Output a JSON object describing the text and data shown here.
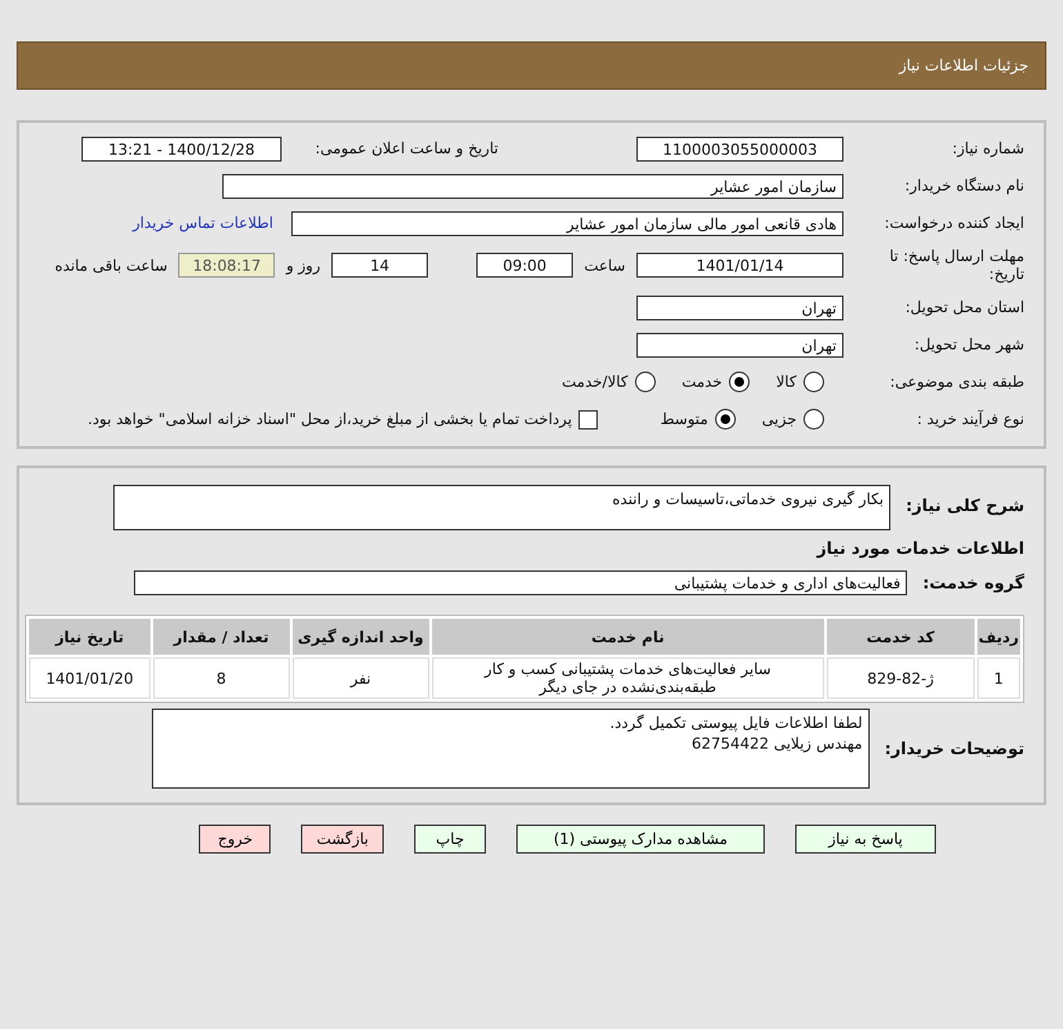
{
  "header": {
    "title": "جزئیات اطلاعات نیاز"
  },
  "details": {
    "need_number": {
      "label": "شماره نیاز:",
      "value": "1100003055000003"
    },
    "announce": {
      "label": "تاریخ و ساعت اعلان عمومی:",
      "value": "1400/12/28 - 13:21"
    },
    "buyer": {
      "label": "نام دستگاه خریدار:",
      "value": "سازمان امور عشایر"
    },
    "requester": {
      "label": "ایجاد کننده درخواست:",
      "value": "هادی قانعی امور مالی سازمان امور عشایر",
      "link": "اطلاعات تماس خریدار"
    },
    "deadline": {
      "label": "مهلت ارسال پاسخ: تا تاریخ:",
      "date": "1401/01/14",
      "time_label": "ساعت",
      "time": "09:00",
      "days": "14",
      "days_label": "روز و",
      "remaining": "18:08:17",
      "remaining_label": "ساعت باقی مانده"
    },
    "province": {
      "label": "استان محل تحویل:",
      "value": "تهران"
    },
    "city": {
      "label": "شهر محل تحویل:",
      "value": "تهران"
    },
    "category": {
      "label": "طبقه بندی موضوعی:",
      "options": [
        {
          "label": "کالا",
          "selected": false
        },
        {
          "label": "خدمت",
          "selected": true
        },
        {
          "label": "کالا/خدمت",
          "selected": false
        }
      ]
    },
    "process": {
      "label": "نوع فرآیند خرید :",
      "options": [
        {
          "label": "جزیی",
          "selected": false
        },
        {
          "label": "متوسط",
          "selected": true
        }
      ],
      "payment": {
        "label": "پرداخت تمام یا بخشی از مبلغ خرید،از محل \"اسناد خزانه اسلامی\" خواهد بود.",
        "checked": false
      }
    }
  },
  "summary": {
    "description": {
      "label": "شرح کلی نیاز:",
      "value": "بکار گیری نیروی خدماتی،تاسیسات و راننده"
    },
    "services_heading": "اطلاعات خدمات مورد نیاز",
    "service_group": {
      "label": "گروه خدمت:",
      "value": "فعالیت‌های اداری و خدمات پشتیبانی"
    },
    "table": {
      "columns": [
        "ردیف",
        "کد خدمت",
        "نام خدمت",
        "واحد اندازه گیری",
        "تعداد / مقدار",
        "تاریخ نیاز"
      ],
      "rows": [
        [
          "1",
          "ژ-82-829",
          "سایر فعالیت‌های خدمات پشتیبانی کسب و کار\nطبقه‌بندی‌نشده در جای دیگر",
          "نفر",
          "8",
          "1401/01/20"
        ]
      ]
    },
    "buyer_notes": {
      "label": "توضیحات خریدار:",
      "lines": [
        "لطفا اطلاعات فایل پیوستی تکمیل گردد.",
        "مهندس زیلایی 62754422"
      ]
    }
  },
  "buttons": [
    {
      "label": "پاسخ به نیاز",
      "kind": "action"
    },
    {
      "label": "مشاهده مدارک پیوستی (1)",
      "kind": "action"
    },
    {
      "label": "چاپ",
      "kind": "action"
    },
    {
      "label": "بازگشت",
      "kind": "exit"
    },
    {
      "label": "خروج",
      "kind": "exit"
    }
  ]
}
